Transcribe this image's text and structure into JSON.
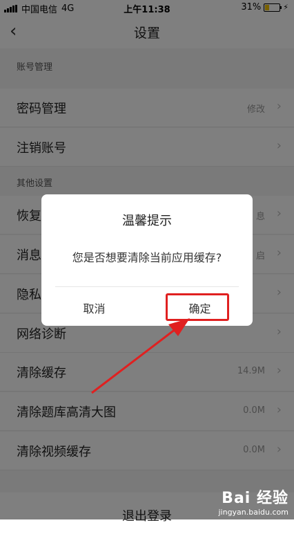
{
  "status_bar": {
    "carrier": "中国电信",
    "network": "4G",
    "time": "上午11:38",
    "battery": "31%",
    "battery_level": 0.31
  },
  "nav": {
    "back_icon": "chevron-left-icon",
    "title": "设置"
  },
  "sections": {
    "account": "账号管理",
    "other": "其他设置"
  },
  "rows": [
    {
      "label": "密码管理",
      "value": "修改"
    },
    {
      "label": "注销账号",
      "value": ""
    },
    {
      "label": "恢复",
      "value": "息"
    },
    {
      "label": "消息",
      "value": "启"
    },
    {
      "label": "隐私",
      "value": ""
    },
    {
      "label": "网络诊断",
      "value": ""
    },
    {
      "label": "清除缓存",
      "value": "14.9M"
    },
    {
      "label": "清除题库高清大图",
      "value": "0.0M"
    },
    {
      "label": "清除视频缓存",
      "value": "0.0M"
    }
  ],
  "logout": "退出登录",
  "dialog": {
    "title": "温馨提示",
    "message": "您是否想要清除当前应用缓存?",
    "cancel": "取消",
    "confirm": "确定"
  },
  "annotation": {
    "color": "#e02020"
  },
  "watermark": {
    "brand": "Bai 经验",
    "site": "jingyan.baidu.com"
  }
}
